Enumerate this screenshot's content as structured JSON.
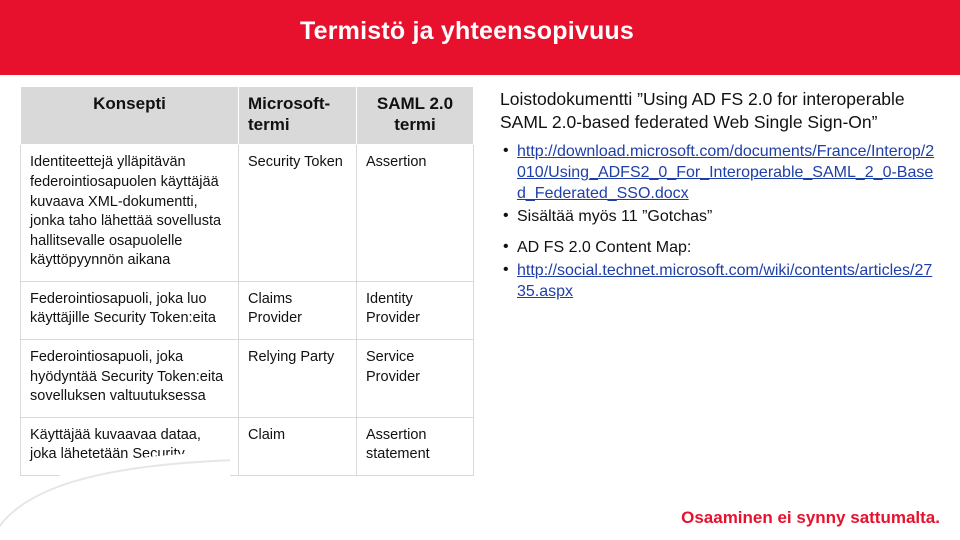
{
  "slide": {
    "title": "Termistö ja yhteensopivuus",
    "accent_color": "#e8112d",
    "header_band_color": "#e8112d",
    "table_header_bg": "#d9d9d9",
    "link_color": "#1f3fa8"
  },
  "table": {
    "headers": [
      "Konsepti",
      "Microsoft-termi",
      "SAML 2.0 termi"
    ],
    "rows": [
      {
        "concept": "Identiteettejä ylläpitävän federointiosapuolen käyttäjää kuvaava XML-dokumentti, jonka taho lähettää sovellusta hallitsevalle osapuolelle käyttöpyynnön aikana",
        "microsoft": "Security Token",
        "saml": "Assertion"
      },
      {
        "concept": "Federointiosapuoli, joka luo käyttäjille Security Token:eita",
        "microsoft": "Claims Provider",
        "saml": "Identity Provider"
      },
      {
        "concept": "Federointiosapuoli, joka hyödyntää Security Token:eita sovelluksen valtuutuksessa",
        "microsoft": "Relying Party",
        "saml": "Service Provider"
      },
      {
        "concept": "Käyttäjää kuvaavaa dataa, joka lähetetään Security",
        "microsoft": "Claim",
        "saml": "Assertion statement"
      }
    ]
  },
  "right": {
    "intro": "Loistodokumentti ”Using AD FS 2.0 for interoperable SAML 2.0-based federated Web Single Sign-On”",
    "bullets": [
      {
        "type": "link",
        "text": "http://download.microsoft.com/documents/France/Interop/2010/Using_ADFS2_0_For_Interoperable_SAML_2_0-Based_Federated_SSO.docx"
      },
      {
        "type": "text",
        "text": "Sisältää myös 11 ”Gotchas”"
      }
    ],
    "section2": {
      "label": "AD FS 2.0 Content Map:",
      "bullets": [
        {
          "type": "link",
          "text": "http://social.technet.microsoft.com/wiki/contents/articles/2735.aspx"
        }
      ]
    }
  },
  "footer": {
    "slogan": "Osaaminen ei synny sattumalta."
  }
}
